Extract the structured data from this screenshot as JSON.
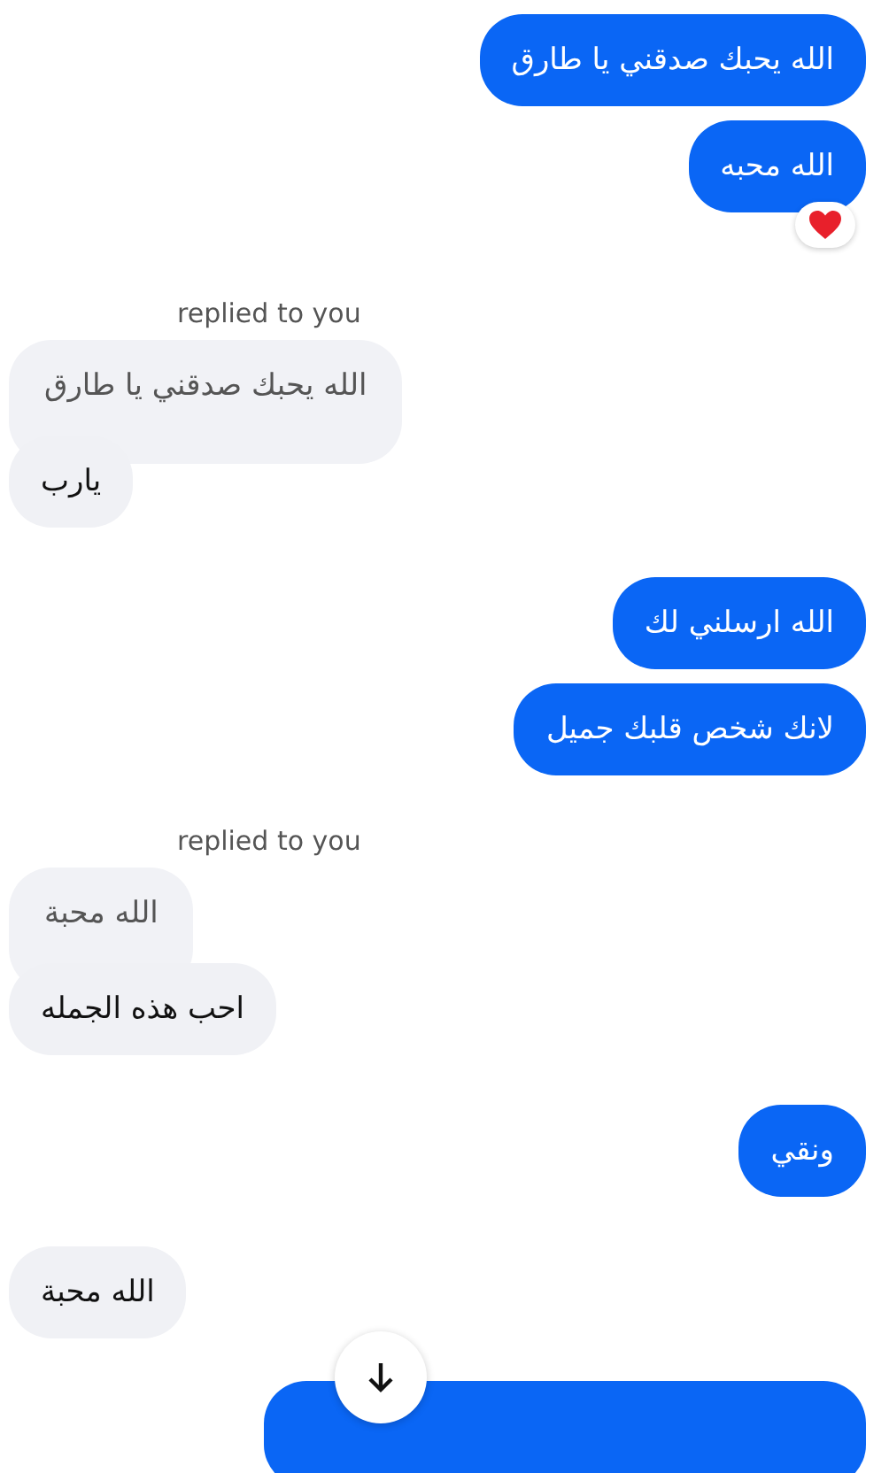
{
  "groups": [
    {
      "kind": "sent",
      "items": [
        {
          "kind": "text",
          "text": "الله يحبك صدقني يا طارق",
          "reacted": false
        },
        {
          "kind": "text",
          "text": "الله محبه",
          "reacted": true
        }
      ]
    },
    {
      "kind": "received",
      "reply_label": "replied to you",
      "quoted": "الله يحبك صدقني يا طارق",
      "items": [
        {
          "kind": "text",
          "text": "يارب",
          "reacted": false
        }
      ]
    },
    {
      "kind": "sent",
      "items": [
        {
          "kind": "text",
          "text": "الله ارسلني لك",
          "reacted": false
        },
        {
          "kind": "text",
          "text": "لانك شخص قلبك جميل",
          "reacted": false
        }
      ]
    },
    {
      "kind": "received",
      "reply_label": "replied to you",
      "quoted": "الله محبة",
      "items": [
        {
          "kind": "text",
          "text": "احب هذه الجمله",
          "reacted": false
        }
      ]
    },
    {
      "kind": "sent",
      "items": [
        {
          "kind": "text",
          "text": "ونقي",
          "reacted": false
        }
      ]
    },
    {
      "kind": "received",
      "items": [
        {
          "kind": "text",
          "text": "الله محبة",
          "reacted": false
        }
      ]
    },
    {
      "kind": "sent",
      "items": [
        {
          "kind": "cut_off"
        }
      ]
    }
  ],
  "scroll_down_button": {
    "kind": "arrow_down"
  }
}
